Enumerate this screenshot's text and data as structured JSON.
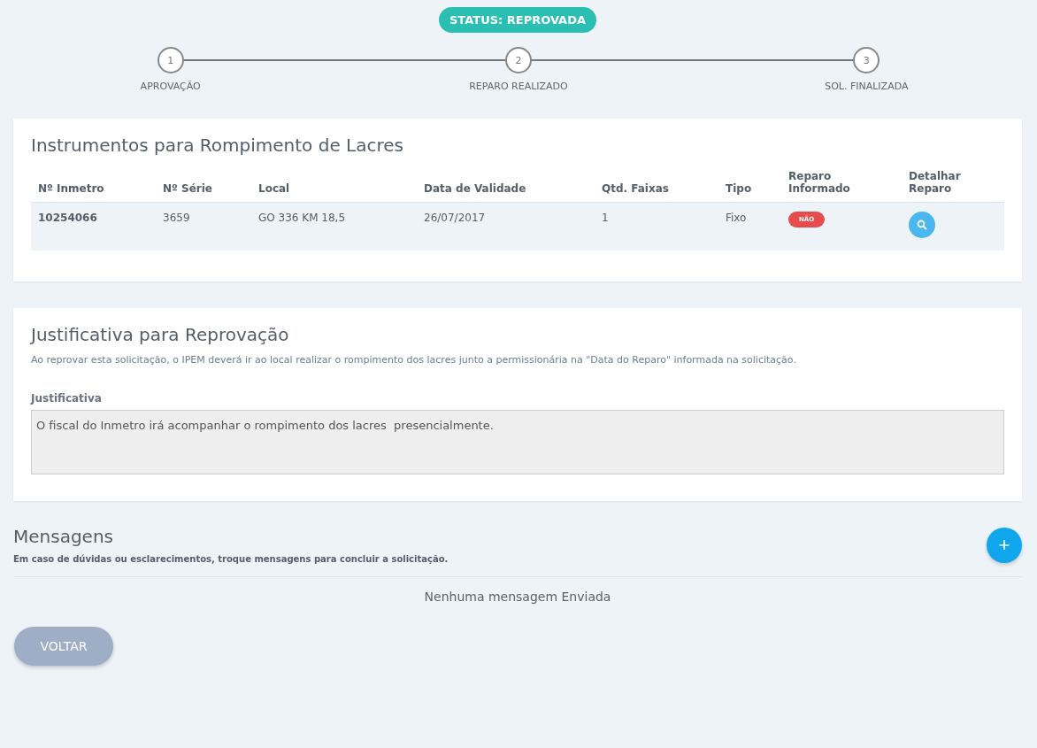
{
  "status": "STATUS: REPROVADA",
  "steps": [
    {
      "number": "1",
      "label": "APROVAÇÃO"
    },
    {
      "number": "2",
      "label": "REPARO REALIZADO"
    },
    {
      "number": "3",
      "label": "SOL. FINALIZADA"
    }
  ],
  "instruments": {
    "title": "Instrumentos para Rompimento de Lacres",
    "columns": [
      "Nº Inmetro",
      "Nº Série",
      "Local",
      "Data de Validade",
      "Qtd. Faixas",
      "Tipo",
      "Reparo Informado",
      "Detalhar Reparo"
    ],
    "rows": [
      {
        "inmetro": "10254066",
        "serie": "3659",
        "local": "GO 336 KM 18,5",
        "validade": "26/07/2017",
        "faixas": "1",
        "tipo": "Fixo",
        "reparo": "NÃO"
      }
    ]
  },
  "justification": {
    "title": "Justificativa para Reprovação",
    "description": "Ao reprovar esta solicitação, o IPEM deverá ir ao local realizar o rompimento dos lacres junto a permissionária na \"Data do Reparo\" informada na solicitação.",
    "field_label": "Justificativa",
    "value": "O fiscal do Inmetro irá acompanhar o rompimento dos lacres  presencialmente."
  },
  "messages": {
    "title": "Mensagens",
    "description": "Em caso de dúvidas ou esclarecimentos, troque mensagens para concluir a solicitação.",
    "add_button": "+",
    "empty": "Nenhuma mensagem Enviada"
  },
  "back_button": "VOLTAR"
}
